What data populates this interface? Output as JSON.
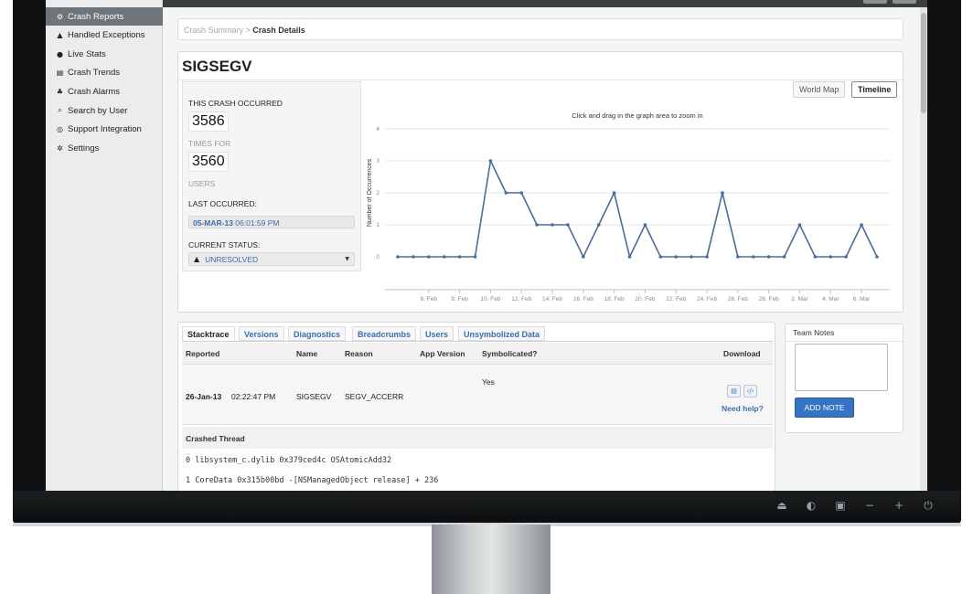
{
  "sidebar": {
    "items": [
      {
        "label": "Crash Reports",
        "icon": "gear-icon",
        "glyph": "⚙",
        "active": true
      },
      {
        "label": "Handled Exceptions",
        "icon": "warning-icon",
        "glyph": "▲",
        "active": false
      },
      {
        "label": "Live Stats",
        "icon": "info-icon",
        "glyph": "●",
        "active": false
      },
      {
        "label": "Crash Trends",
        "icon": "chart-icon",
        "glyph": "▤",
        "active": false
      },
      {
        "label": "Crash Alarms",
        "icon": "bell-icon",
        "glyph": "♣",
        "active": false
      },
      {
        "label": "Search by User",
        "icon": "search-icon",
        "glyph": "⌕",
        "active": false
      },
      {
        "label": "Support Integration",
        "icon": "chat-icon",
        "glyph": "◎",
        "active": false
      },
      {
        "label": "Settings",
        "icon": "settings-icon",
        "glyph": "✲",
        "active": false
      }
    ]
  },
  "breadcrumb": {
    "parent": "Crash Summary",
    "separator": " > ",
    "current": "Crash Details"
  },
  "crash": {
    "title": "SIGSEGV",
    "occurred_label": "THIS CRASH OCCURRED",
    "times": "3586",
    "times_label": "TIMES FOR",
    "users": "3560",
    "users_label": "USERS",
    "last_label": "LAST OCCURRED:",
    "last_date": "05-MAR-13",
    "last_time": " 06:01:59 PM",
    "status_label": "CURRENT STATUS:",
    "status_value": "UNRESOLVED"
  },
  "view_toggle": {
    "world_map": "World Map",
    "timeline": "Timeline"
  },
  "chart_data": {
    "type": "line",
    "title": "Click and drag in the graph area to zoom in",
    "xlabel": "",
    "ylabel": "Number of Occurrences",
    "ylim": [
      0,
      4
    ],
    "yticks": [
      "0",
      "1",
      "2",
      "3",
      "4"
    ],
    "xticks": [
      "6. Feb",
      "8. Feb",
      "10. Feb",
      "12. Feb",
      "14. Feb",
      "16. Feb",
      "18. Feb",
      "20. Feb",
      "22. Feb",
      "24. Feb",
      "26. Feb",
      "28. Feb",
      "2. Mar",
      "4. Mar",
      "6. Mar"
    ],
    "x": [
      "4. Feb",
      "5. Feb",
      "6. Feb",
      "7. Feb",
      "8. Feb",
      "9. Feb",
      "10. Feb",
      "11. Feb",
      "12. Feb",
      "13. Feb",
      "14. Feb",
      "15. Feb",
      "16. Feb",
      "17. Feb",
      "18. Feb",
      "19. Feb",
      "20. Feb",
      "21. Feb",
      "22. Feb",
      "23. Feb",
      "24. Feb",
      "25. Feb",
      "26. Feb",
      "27. Feb",
      "28. Feb",
      "1. Mar",
      "2. Mar",
      "3. Mar",
      "4. Mar",
      "5. Mar",
      "6. Mar",
      "7. Mar"
    ],
    "values": [
      0,
      0,
      0,
      0,
      0,
      0,
      3,
      2,
      2,
      1,
      1,
      1,
      0,
      1,
      2,
      0,
      1,
      0,
      0,
      0,
      0,
      2,
      0,
      0,
      0,
      0,
      1,
      0,
      0,
      0,
      1,
      0
    ],
    "grid": true,
    "color": "#4a6e9c"
  },
  "tabs": [
    "Stacktrace",
    "Versions",
    "Diagnostics",
    "Breadcrumbs",
    "Users",
    "Unsymbolized Data"
  ],
  "table": {
    "headers": {
      "reported": "Reported",
      "name": "Name",
      "reason": "Reason",
      "app_version": "App Version",
      "symbolicated": "Symbolicated?",
      "download": "Download"
    },
    "row": {
      "date": "26-Jan-13",
      "time": "02:22:47 PM",
      "name": "SIGSEGV",
      "reason": "SEGV_ACCERR",
      "app_version": "",
      "symbolicated": "Yes"
    },
    "need_help": "Need help?"
  },
  "thread": {
    "title": "Crashed Thread",
    "lines": [
      "0  libsystem_c.dylib 0x379ced4c OSAtomicAdd32",
      "1  CoreData 0x315b00bd -[NSManagedObject release] + 236"
    ]
  },
  "notes": {
    "title": "Team Notes",
    "button": "ADD NOTE"
  },
  "bezel": {
    "buttons": [
      "⏏",
      "◐",
      "▣",
      "−",
      "+",
      "⏻"
    ]
  }
}
